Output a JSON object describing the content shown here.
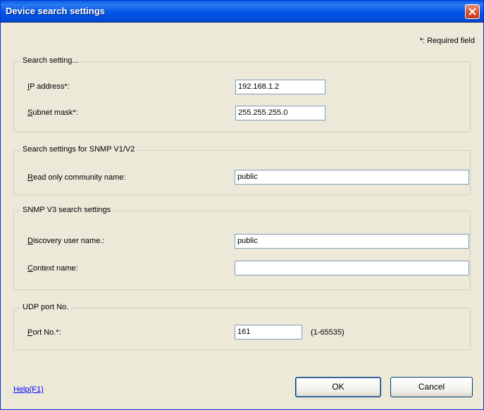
{
  "window": {
    "title": "Device search settings"
  },
  "required_note": "*: Required field",
  "search_setting": {
    "legend": "Search setting...",
    "ip_label_key": "I",
    "ip_label_rest": "P address*:",
    "ip_value": "192.168.1.2",
    "mask_label_key": "S",
    "mask_label_rest": "ubnet mask*:",
    "mask_value": "255.255.255.0"
  },
  "snmp_v1v2": {
    "legend": "Search settings for SNMP V1/V2",
    "community_label_key": "R",
    "community_label_rest": "ead only community name:",
    "community_value": "public"
  },
  "snmp_v3": {
    "legend": "SNMP V3 search settings",
    "user_label_key": "D",
    "user_label_rest": "iscovery user name.:",
    "user_value": "public",
    "context_label_key": "C",
    "context_label_rest": "ontext name:",
    "context_value": ""
  },
  "udp": {
    "legend": "UDP port No.",
    "port_label_key": "P",
    "port_label_rest": "ort No.*:",
    "port_value": "161",
    "port_range": "(1-65535)"
  },
  "footer": {
    "help_label": "Help(F1)",
    "ok_label": "OK",
    "cancel_label": "Cancel"
  },
  "icons": {
    "close": "close-icon"
  },
  "colors": {
    "titlebar": "#0055e5",
    "close_button": "#d84a2b",
    "link": "#0000ff",
    "face": "#ece9d8"
  }
}
